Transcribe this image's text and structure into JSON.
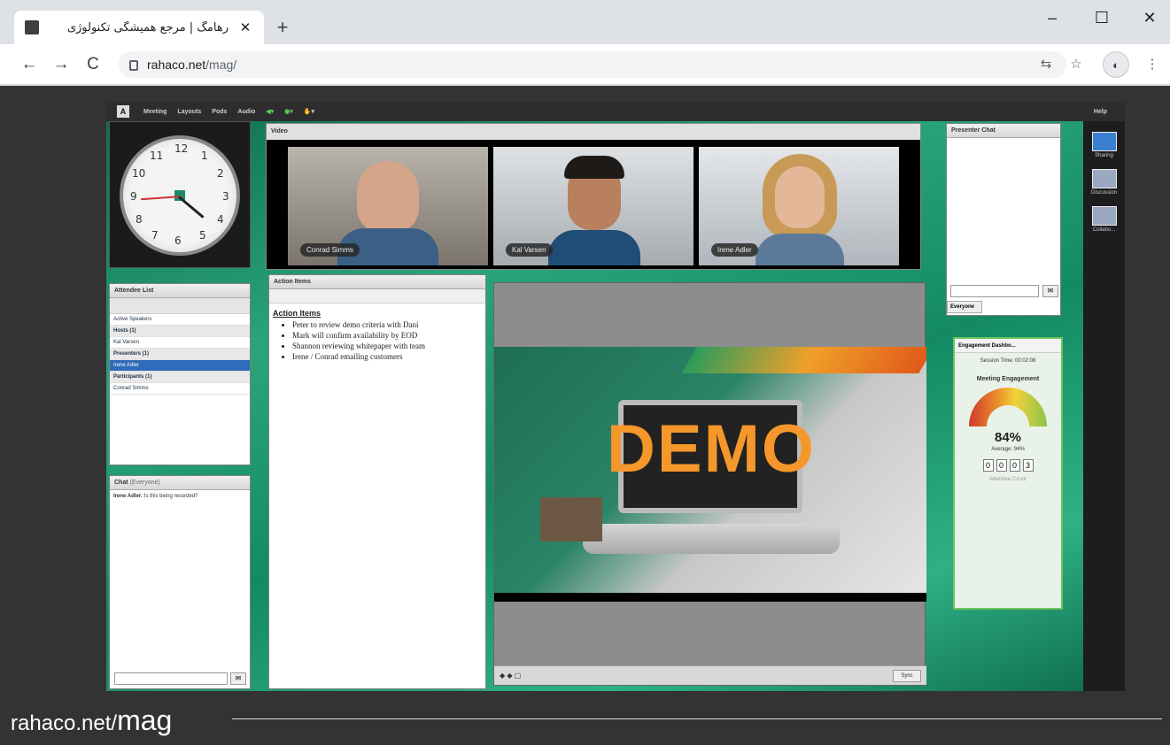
{
  "browser": {
    "tab_title": "رهامگ | مرجع همیشگی تکنولوژی",
    "new_tab": "+",
    "close_tab": "✕",
    "minimize": "–",
    "maximize": "☐",
    "close_window": "✕",
    "url_host": "rahaco.net",
    "url_path": "/mag/"
  },
  "app": {
    "menu": [
      "Meeting",
      "Layouts",
      "Pods",
      "Audio"
    ],
    "help": "Help",
    "video_pod_title": "Video",
    "participants": [
      "Conrad Simms",
      "Kal Varsen",
      "Irene Adler"
    ],
    "attendee_list_title": "Attendee List",
    "attendees": [
      {
        "text": "Active Speakers",
        "type": "item"
      },
      {
        "text": "Hosts (1)",
        "type": "group"
      },
      {
        "text": "Kal Varsen",
        "type": "item"
      },
      {
        "text": "Presenters (1)",
        "type": "group"
      },
      {
        "text": "Irene Adler",
        "type": "selected"
      },
      {
        "text": "Participants (1)",
        "type": "group"
      },
      {
        "text": "Conrad Simms",
        "type": "item"
      }
    ],
    "chat_title": "Chat",
    "chat_scope": "(Everyone)",
    "chat_sender": "Irene Adler:",
    "chat_message": "Is this being recorded?",
    "action_items_title": "Action Items",
    "action_heading": "Action Items",
    "action_items": [
      "Peter to review demo criteria with Dani",
      "Mark will confirm availability by EOD",
      "Shannon reviewing whitepaper with team",
      "Irene / Conrad emailing customers"
    ],
    "share_text": "DEMO",
    "sync_label": "Sync",
    "presenter_chat_title": "Presenter Chat",
    "presenter_chat_tab": "Everyone",
    "engagement_title": "Engagement Dashbo...",
    "session_time": "Session Time: 00:02:08",
    "meeting_engagement": "Meeting Engagement",
    "engagement_pct": "84%",
    "engagement_avg": "Average: 94%",
    "attendee_count_digits": [
      "0",
      "0",
      "0",
      "3"
    ],
    "attendee_count_label": "Attendee Count",
    "rail": [
      "Sharing",
      "Discussion",
      "Collabo..."
    ]
  },
  "watermark": {
    "text_regular": "rahaco.net/",
    "text_large": "mag"
  }
}
